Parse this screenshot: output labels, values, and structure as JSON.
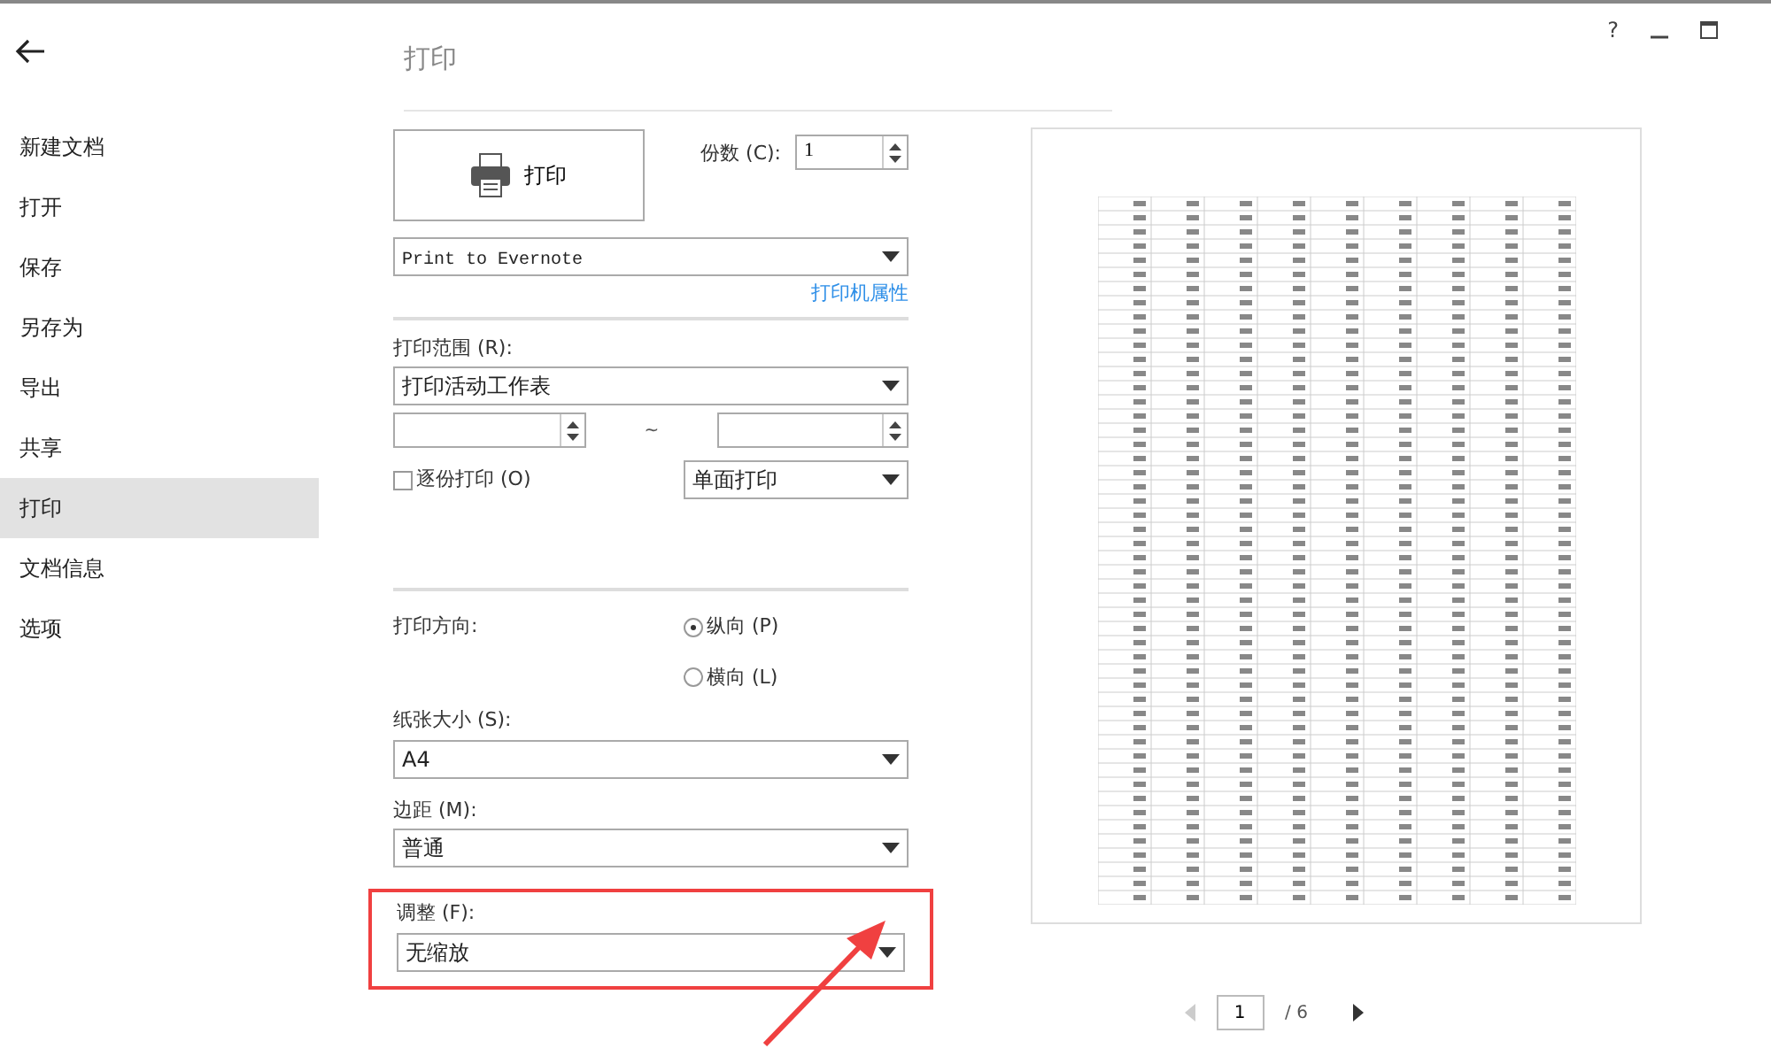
{
  "window_controls": {
    "help": "?"
  },
  "sidebar": {
    "items": [
      {
        "label": "新建文档",
        "selected": false
      },
      {
        "label": "打开",
        "selected": false
      },
      {
        "label": "保存",
        "selected": false
      },
      {
        "label": "另存为",
        "selected": false
      },
      {
        "label": "导出",
        "selected": false
      },
      {
        "label": "共享",
        "selected": false
      },
      {
        "label": "打印",
        "selected": true
      },
      {
        "label": "文档信息",
        "selected": false
      },
      {
        "label": "选项",
        "selected": false
      }
    ]
  },
  "title": "打印",
  "print_button": "打印",
  "copies": {
    "label": "份数 (C):",
    "value": "1"
  },
  "printer": {
    "value": "Print to Evernote",
    "link": "打印机属性"
  },
  "range": {
    "label": "打印范围 (R):",
    "value": "打印活动工作表",
    "separator": "~"
  },
  "collate": {
    "label": "逐份打印 (O)",
    "checked": false
  },
  "sides": {
    "value": "单面打印"
  },
  "orientation": {
    "label": "打印方向:",
    "options": [
      {
        "label": "纵向 (P)",
        "selected": true
      },
      {
        "label": "横向 (L)",
        "selected": false
      }
    ]
  },
  "paper": {
    "label": "纸张大小 (S):",
    "value": "A4"
  },
  "margins": {
    "label": "边距 (M):",
    "value": "普通"
  },
  "scaling": {
    "label": "调整 (F):",
    "value": "无缩放",
    "highlighted": true
  },
  "pager": {
    "page": "1",
    "total": "/ 6"
  }
}
